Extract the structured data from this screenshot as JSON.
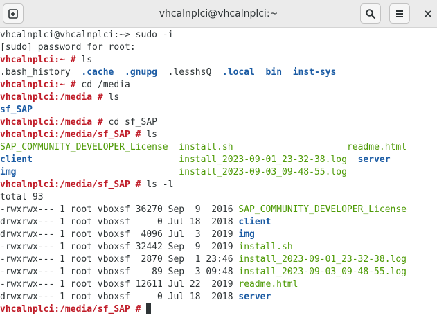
{
  "window": {
    "title": "vhcalnplci@vhcalnplci:~"
  },
  "icons": {
    "new_tab": "new-tab-icon",
    "search": "search-icon",
    "menu": "hamburger-menu-icon",
    "close": "close-icon"
  },
  "colors": {
    "prompt": "#c01c28",
    "directory": "#1c5ca4",
    "executable": "#4e9a06",
    "text": "#2e3436"
  },
  "terminal": {
    "lines": [
      {
        "segs": [
          {
            "t": "vhcalnplci@vhcalnplci:~> sudo -i"
          }
        ]
      },
      {
        "segs": [
          {
            "t": "[sudo] password for root:"
          }
        ]
      },
      {
        "segs": [
          {
            "t": "vhcalnplci:~ #",
            "c": "p"
          },
          {
            "t": " ls"
          }
        ]
      },
      {
        "segs": [
          {
            "t": ".bash_history  "
          },
          {
            "t": ".cache",
            "c": "b"
          },
          {
            "t": "  "
          },
          {
            "t": ".gnupg",
            "c": "b"
          },
          {
            "t": "  .lesshsQ  "
          },
          {
            "t": ".local",
            "c": "b"
          },
          {
            "t": "  "
          },
          {
            "t": "bin",
            "c": "b"
          },
          {
            "t": "  "
          },
          {
            "t": "inst-sys",
            "c": "b"
          }
        ]
      },
      {
        "segs": [
          {
            "t": "vhcalnplci:~ #",
            "c": "p"
          },
          {
            "t": " cd /media"
          }
        ]
      },
      {
        "segs": [
          {
            "t": "vhcalnplci:/media #",
            "c": "p"
          },
          {
            "t": " ls"
          }
        ]
      },
      {
        "segs": [
          {
            "t": "sf_SAP",
            "c": "b"
          }
        ]
      },
      {
        "segs": [
          {
            "t": "vhcalnplci:/media #",
            "c": "p"
          },
          {
            "t": " cd sf_SAP"
          }
        ]
      },
      {
        "segs": [
          {
            "t": "vhcalnplci:/media/sf_SAP #",
            "c": "p"
          },
          {
            "t": " ls"
          }
        ]
      },
      {
        "segs": [
          {
            "t": "SAP_COMMUNITY_DEVELOPER_License",
            "c": "g"
          },
          {
            "t": "  "
          },
          {
            "t": "install.sh",
            "c": "g"
          },
          {
            "t": "                     "
          },
          {
            "t": "readme.html",
            "c": "g"
          }
        ]
      },
      {
        "segs": [
          {
            "t": "client",
            "c": "b"
          },
          {
            "t": "                           "
          },
          {
            "t": "install_2023-09-01_23-32-38.log",
            "c": "g"
          },
          {
            "t": "  "
          },
          {
            "t": "server",
            "c": "b"
          }
        ]
      },
      {
        "segs": [
          {
            "t": "img",
            "c": "b"
          },
          {
            "t": "                              "
          },
          {
            "t": "install_2023-09-03_09-48-55.log",
            "c": "g"
          }
        ]
      },
      {
        "segs": [
          {
            "t": "vhcalnplci:/media/sf_SAP #",
            "c": "p"
          },
          {
            "t": " ls -l"
          }
        ]
      },
      {
        "segs": [
          {
            "t": "total 93"
          }
        ]
      },
      {
        "segs": [
          {
            "t": "-rwxrwx--- 1 root vboxsf 36270 Sep  9  2016 "
          },
          {
            "t": "SAP_COMMUNITY_DEVELOPER_License",
            "c": "g"
          }
        ]
      },
      {
        "segs": [
          {
            "t": "drwxrwx--- 1 root vboxsf     0 Jul 18  2018 "
          },
          {
            "t": "client",
            "c": "b"
          }
        ]
      },
      {
        "segs": [
          {
            "t": "drwxrwx--- 1 root vboxsf  4096 Jul  3  2019 "
          },
          {
            "t": "img",
            "c": "b"
          }
        ]
      },
      {
        "segs": [
          {
            "t": "-rwxrwx--- 1 root vboxsf 32442 Sep  9  2019 "
          },
          {
            "t": "install.sh",
            "c": "g"
          }
        ]
      },
      {
        "segs": [
          {
            "t": "-rwxrwx--- 1 root vboxsf  2870 Sep  1 23:46 "
          },
          {
            "t": "install_2023-09-01_23-32-38.log",
            "c": "g"
          }
        ]
      },
      {
        "segs": [
          {
            "t": "-rwxrwx--- 1 root vboxsf    89 Sep  3 09:48 "
          },
          {
            "t": "install_2023-09-03_09-48-55.log",
            "c": "g"
          }
        ]
      },
      {
        "segs": [
          {
            "t": "-rwxrwx--- 1 root vboxsf 12611 Jul 22  2019 "
          },
          {
            "t": "readme.html",
            "c": "g"
          }
        ]
      },
      {
        "segs": [
          {
            "t": "drwxrwx--- 1 root vboxsf     0 Jul 18  2018 "
          },
          {
            "t": "server",
            "c": "b"
          }
        ]
      },
      {
        "segs": [
          {
            "t": "vhcalnplci:/media/sf_SAP #",
            "c": "p"
          },
          {
            "t": " "
          }
        ],
        "cursor": true
      }
    ]
  }
}
